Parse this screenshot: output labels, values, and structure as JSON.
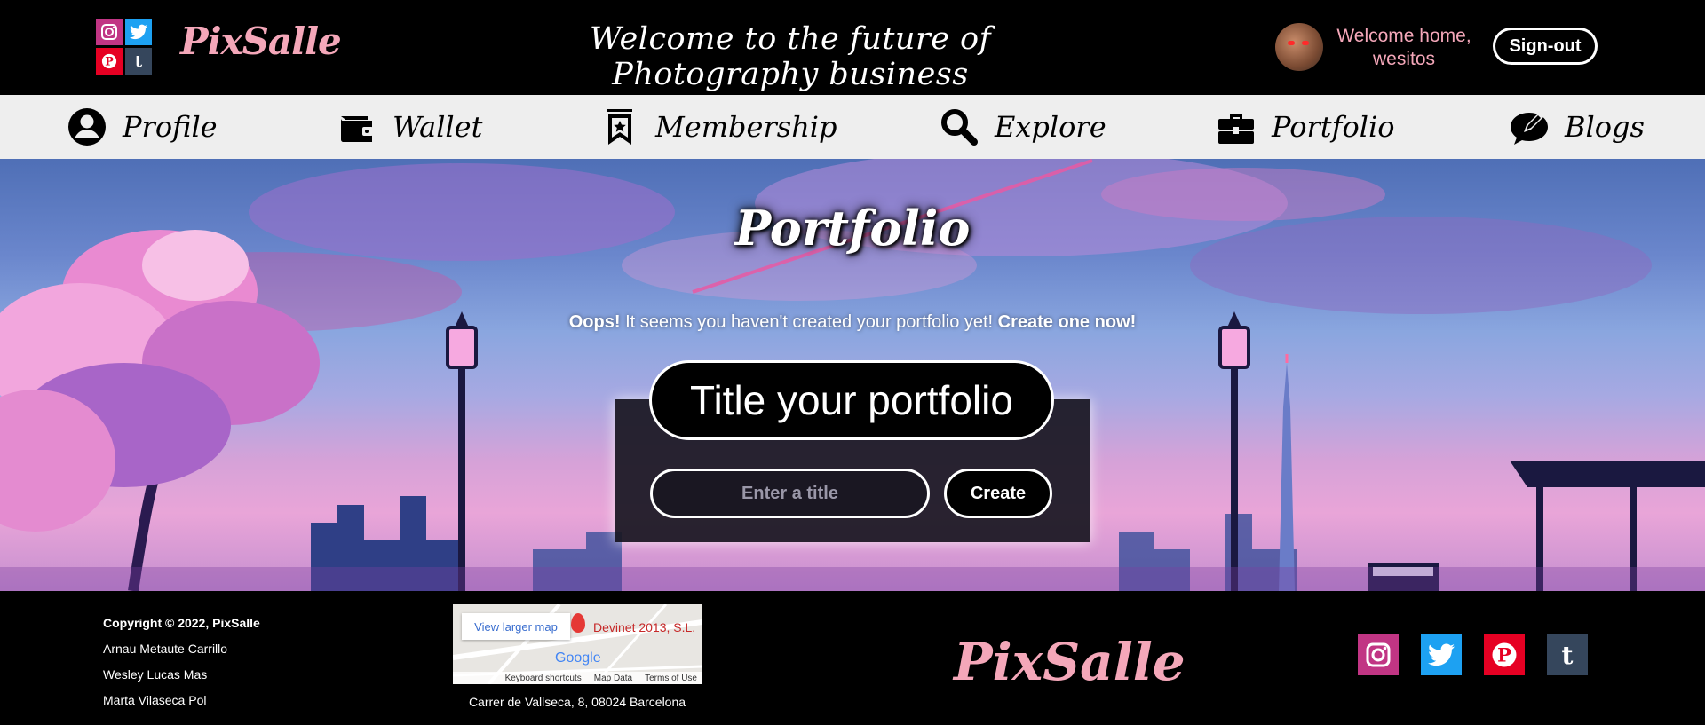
{
  "header": {
    "logo": "PixSalle",
    "tagline": "Welcome to the future of Photography business",
    "welcome": "Welcome home, wesitos",
    "signout_label": "Sign-out",
    "social": [
      {
        "icon": "instagram-icon",
        "color": "#c13584"
      },
      {
        "icon": "twitter-icon",
        "color": "#1da1f2"
      },
      {
        "icon": "pinterest-icon",
        "color": "#e60023"
      },
      {
        "icon": "tumblr-icon",
        "color": "#35465c"
      }
    ]
  },
  "nav": {
    "items": [
      {
        "label": "Profile",
        "icon": "user-circle-icon"
      },
      {
        "label": "Wallet",
        "icon": "wallet-icon"
      },
      {
        "label": "Membership",
        "icon": "bookmark-star-icon"
      },
      {
        "label": "Explore",
        "icon": "search-icon"
      },
      {
        "label": "Portfolio",
        "icon": "briefcase-icon"
      },
      {
        "label": "Blogs",
        "icon": "comment-pen-icon"
      }
    ]
  },
  "hero": {
    "title": "Portfolio",
    "notice_strong": "Oops!",
    "notice_text": " It seems you haven't created your portfolio yet! ",
    "notice_cta": "Create one now!",
    "form_heading": "Title your portfolio",
    "input_placeholder": "Enter a title",
    "input_value": "",
    "create_label": "Create"
  },
  "footer": {
    "copyright": "Copyright © 2022, PixSalle",
    "authors": [
      "Arnau Metaute Carrillo",
      "Wesley Lucas Mas",
      "Marta Vilaseca Pol"
    ],
    "map": {
      "link_label": "View larger map",
      "place": "Devinet 2013, S.L.",
      "brand": "Google",
      "bar_items": [
        "Keyboard shortcuts",
        "Map Data",
        "Terms of Use"
      ]
    },
    "address": "Carrer de Vallseca, 8, 08024 Barcelona",
    "logo": "PixSalle"
  },
  "colors": {
    "brand_pink": "#f4a7b9",
    "nav_bg": "#eeeeee",
    "panel_bg": "#1a1822"
  }
}
